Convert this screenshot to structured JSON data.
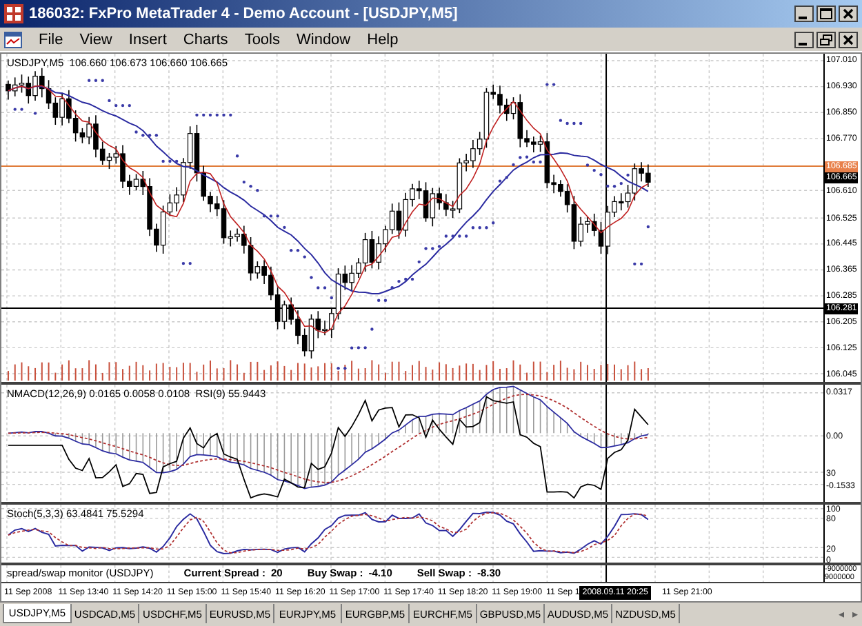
{
  "window": {
    "title": "186032: FxPro MetaTrader 4 - Demo Account - [USDJPY,M5]"
  },
  "menu": [
    "File",
    "View",
    "Insert",
    "Charts",
    "Tools",
    "Window",
    "Help"
  ],
  "main_chart": {
    "header": "USDJPY,M5  106.660 106.673 106.660 106.665",
    "price_ticks": [
      "107.010",
      "106.930",
      "106.850",
      "106.770",
      "106.610",
      "106.525",
      "106.445",
      "106.365",
      "106.285",
      "106.205",
      "106.125",
      "106.045"
    ],
    "ask_label": "106.685",
    "bid_label": "106.665",
    "crosshair_price": "106.281"
  },
  "macd_panel": {
    "header": "NMACD(12,26,9) 0.0165 0.0058 0.0108  RSI(9) 55.9443",
    "ticks": [
      "0.0317",
      "0.00",
      "30",
      "-0.1533"
    ]
  },
  "stoch_panel": {
    "header": "Stoch(5,3,3) 63.4841 75.5294",
    "ticks": [
      "100",
      "80",
      "20",
      "0"
    ]
  },
  "spread_panel": {
    "name": "spread/swap monitor (USDJPY)",
    "fields": [
      {
        "label": "Current Spread :",
        "value": "20"
      },
      {
        "label": "Buy Swap :",
        "value": "-4.10"
      },
      {
        "label": "Sell Swap :",
        "value": "-8.30"
      }
    ],
    "ticks": [
      "-9000000",
      "9000000"
    ]
  },
  "time_axis": {
    "before_crosshair": [
      "11 Sep 2008",
      "11 Sep 13:40",
      "11 Sep 14:20",
      "11 Sep 15:00",
      "11 Sep 15:40",
      "11 Sep 16:20",
      "11 Sep 17:00",
      "11 Sep 17:40",
      "11 Sep 18:20",
      "11 Sep 19:00",
      "11 Sep 1"
    ],
    "crosshair_time": "2008.09.11 20:25",
    "after_crosshair": [
      "11 Sep 21:00"
    ]
  },
  "tabs": [
    {
      "label": "USDJPY,M5",
      "selected": true
    },
    {
      "label": "USDCAD,M5",
      "selected": false
    },
    {
      "label": "USDCHF,M5",
      "selected": false
    },
    {
      "label": "EURUSD,M5",
      "selected": false
    },
    {
      "label": "EURJPY,M5",
      "selected": false
    },
    {
      "label": "EURGBP,M5",
      "selected": false
    },
    {
      "label": "EURCHF,M5",
      "selected": false
    },
    {
      "label": "GBPUSD,M5",
      "selected": false
    },
    {
      "label": "AUDUSD,M5",
      "selected": false
    },
    {
      "label": "NZDUSD,M5",
      "selected": false
    }
  ],
  "tab_scroll": [
    "◂",
    "▸"
  ]
}
